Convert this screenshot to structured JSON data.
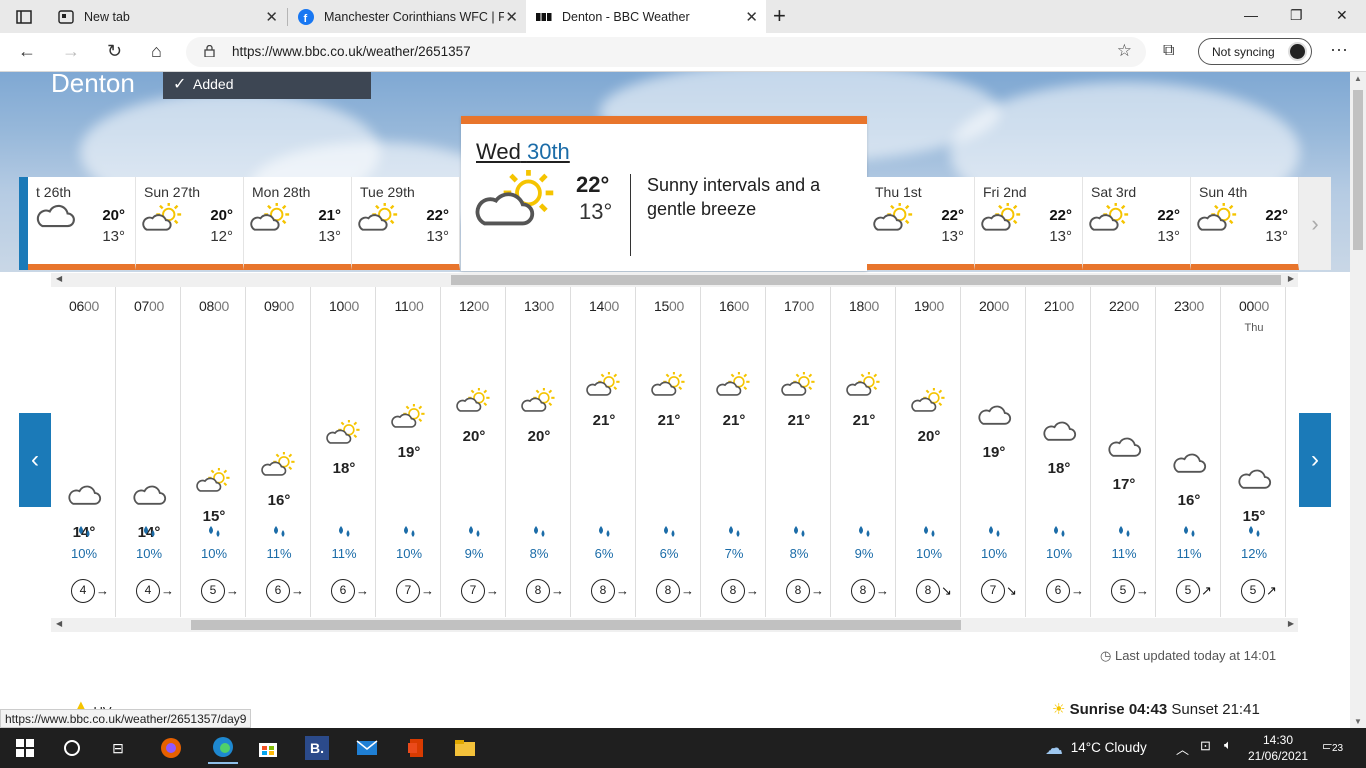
{
  "browser": {
    "tabs": [
      {
        "title": "New tab",
        "favicon": "new-tab-icon"
      },
      {
        "title": "Manchester Corinthians WFC | Fa",
        "favicon": "facebook-icon"
      },
      {
        "title": "Denton - BBC Weather",
        "favicon": "bbc-icon",
        "active": true
      }
    ],
    "url": "https://www.bbc.co.uk/weather/2651357",
    "sync_label": "Not syncing"
  },
  "location": {
    "name": "Denton",
    "added_label": "Added"
  },
  "days_left": [
    {
      "name": "t 26th",
      "hi": "20°",
      "lo": "13°",
      "icon": "cloud"
    },
    {
      "name": "Sun 27th",
      "hi": "20°",
      "lo": "12°",
      "icon": "sun-cloud"
    },
    {
      "name": "Mon 28th",
      "hi": "21°",
      "lo": "13°",
      "icon": "sun-cloud"
    },
    {
      "name": "Tue 29th",
      "hi": "22°",
      "lo": "13°",
      "icon": "sun-cloud"
    }
  ],
  "selected_day": {
    "dayname": "Wed",
    "date": "30th",
    "hi": "22°",
    "lo": "13°",
    "description": "Sunny intervals and a gentle breeze"
  },
  "days_right": [
    {
      "name": "Thu 1st",
      "hi": "22°",
      "lo": "13°",
      "icon": "sun-cloud"
    },
    {
      "name": "Fri 2nd",
      "hi": "22°",
      "lo": "13°",
      "icon": "sun-cloud"
    },
    {
      "name": "Sat 3rd",
      "hi": "22°",
      "lo": "13°",
      "icon": "sun-cloud"
    },
    {
      "name": "Sun 4th",
      "hi": "22°",
      "lo": "13°",
      "icon": "sun-cloud"
    }
  ],
  "hours": [
    {
      "h": "06",
      "m": "00",
      "temp": "14°",
      "rain": "10%",
      "wind": "4",
      "icon": "cloud",
      "dir": "→"
    },
    {
      "h": "07",
      "m": "00",
      "temp": "14°",
      "rain": "10%",
      "wind": "4",
      "icon": "cloud",
      "dir": "→"
    },
    {
      "h": "08",
      "m": "00",
      "temp": "15°",
      "rain": "10%",
      "wind": "5",
      "icon": "sun-cloud",
      "dir": "→"
    },
    {
      "h": "09",
      "m": "00",
      "temp": "16°",
      "rain": "11%",
      "wind": "6",
      "icon": "sun-cloud",
      "dir": "→"
    },
    {
      "h": "10",
      "m": "00",
      "temp": "18°",
      "rain": "11%",
      "wind": "6",
      "icon": "sun-cloud",
      "dir": "→"
    },
    {
      "h": "11",
      "m": "00",
      "temp": "19°",
      "rain": "10%",
      "wind": "7",
      "icon": "sun-cloud",
      "dir": "→"
    },
    {
      "h": "12",
      "m": "00",
      "temp": "20°",
      "rain": "9%",
      "wind": "7",
      "icon": "sun-cloud",
      "dir": "→"
    },
    {
      "h": "13",
      "m": "00",
      "temp": "20°",
      "rain": "8%",
      "wind": "8",
      "icon": "sun-cloud",
      "dir": "→"
    },
    {
      "h": "14",
      "m": "00",
      "temp": "21°",
      "rain": "6%",
      "wind": "8",
      "icon": "sun-cloud",
      "dir": "→"
    },
    {
      "h": "15",
      "m": "00",
      "temp": "21°",
      "rain": "6%",
      "wind": "8",
      "icon": "sun-cloud",
      "dir": "→"
    },
    {
      "h": "16",
      "m": "00",
      "temp": "21°",
      "rain": "7%",
      "wind": "8",
      "icon": "sun-cloud",
      "dir": "→"
    },
    {
      "h": "17",
      "m": "00",
      "temp": "21°",
      "rain": "8%",
      "wind": "8",
      "icon": "sun-cloud",
      "dir": "→"
    },
    {
      "h": "18",
      "m": "00",
      "temp": "21°",
      "rain": "9%",
      "wind": "8",
      "icon": "sun-cloud",
      "dir": "→"
    },
    {
      "h": "19",
      "m": "00",
      "temp": "20°",
      "rain": "10%",
      "wind": "8",
      "icon": "sun-cloud",
      "dir": "↘"
    },
    {
      "h": "20",
      "m": "00",
      "temp": "19°",
      "rain": "10%",
      "wind": "7",
      "icon": "cloud",
      "dir": "↘"
    },
    {
      "h": "21",
      "m": "00",
      "temp": "18°",
      "rain": "10%",
      "wind": "6",
      "icon": "cloud",
      "dir": "→"
    },
    {
      "h": "22",
      "m": "00",
      "temp": "17°",
      "rain": "11%",
      "wind": "5",
      "icon": "cloud",
      "dir": "→"
    },
    {
      "h": "23",
      "m": "00",
      "temp": "16°",
      "rain": "11%",
      "wind": "5",
      "icon": "cloud",
      "dir": "↗"
    },
    {
      "h": "00",
      "m": "00",
      "temp": "15°",
      "rain": "12%",
      "wind": "5",
      "icon": "cloud",
      "dir": "↗",
      "day": "Thu"
    }
  ],
  "last_updated": "Last updated today at 14:01",
  "status_url": "https://www.bbc.co.uk/weather/2651357/day9",
  "sunrise_label": "Sunrise",
  "sunrise": "04:43",
  "sunset_label": "Sunset",
  "sunset": "21:41",
  "uv_label": "UV",
  "taskbar": {
    "weather": "14°C  Cloudy",
    "time": "14:30",
    "date": "21/06/2021",
    "notifications": "23"
  },
  "colors": {
    "accent": "#e8752c",
    "nav_blue": "#1b7ab8",
    "rain_blue": "#1b6ca8",
    "sun": "#f5c400"
  }
}
